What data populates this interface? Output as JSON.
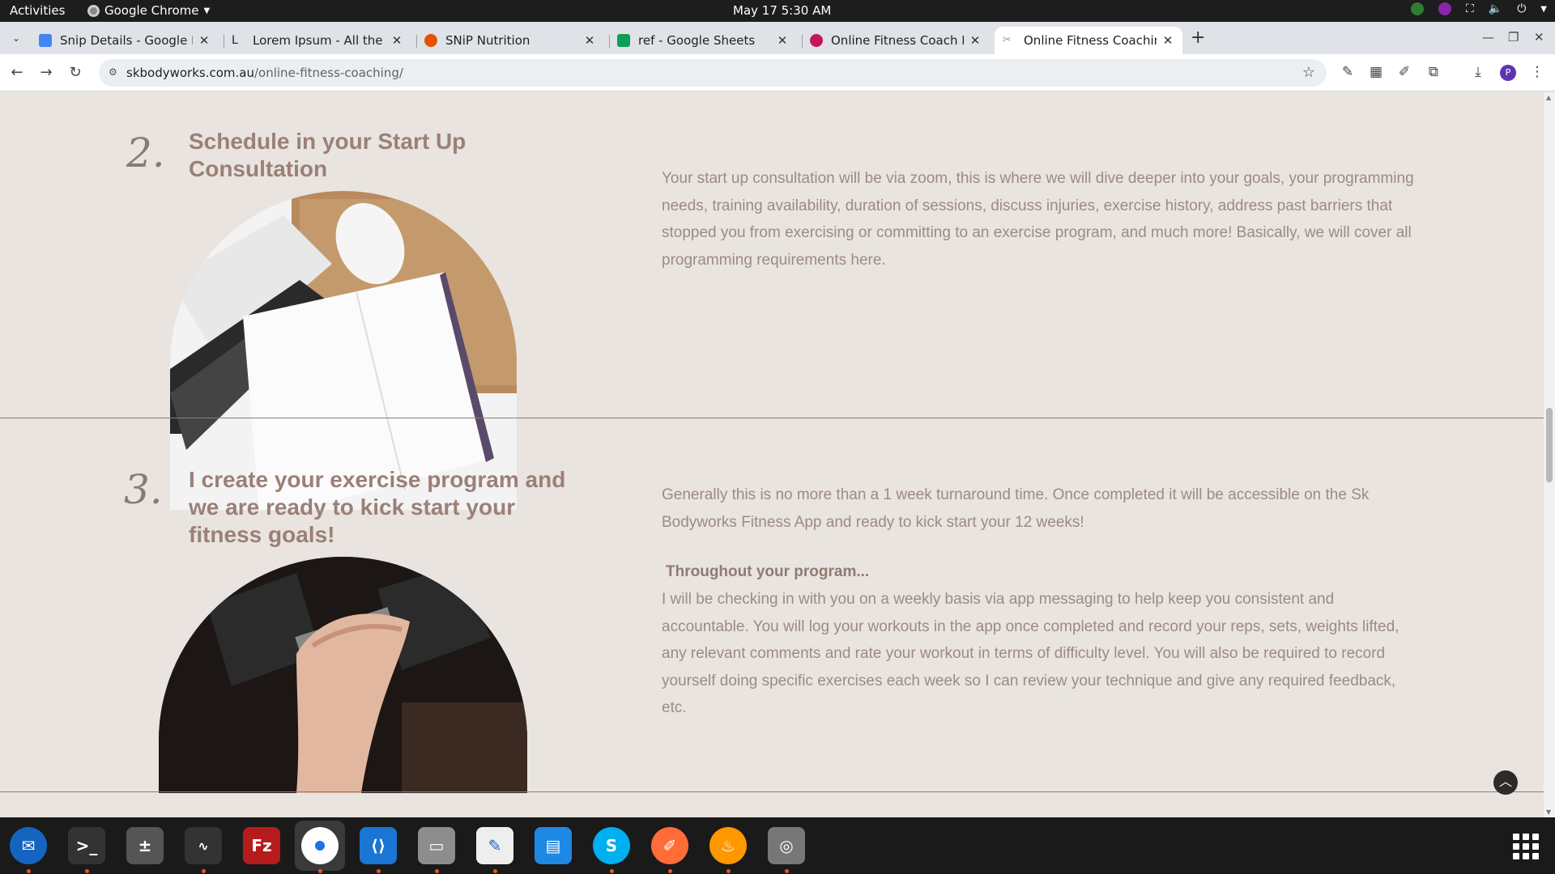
{
  "topbar": {
    "activities": "Activities",
    "app_name": "Google Chrome",
    "clock": "May 17  5:30 AM"
  },
  "tabs": [
    {
      "title": "Snip Details - Google Do",
      "icon": "docs-icon",
      "color": "#4285f4"
    },
    {
      "title": "Lorem Ipsum - All the fac",
      "icon": "lorem-icon",
      "color": "#ffffff"
    },
    {
      "title": "SNiP Nutrition",
      "icon": "snip-icon",
      "color": "#e65100"
    },
    {
      "title": "ref - Google Sheets",
      "icon": "sheets-icon",
      "color": "#0f9d58"
    },
    {
      "title": "Online Fitness Coach Bri",
      "icon": "canva-icon",
      "color": "#c2185b"
    },
    {
      "title": "Online Fitness Coaching",
      "icon": "sk-icon",
      "color": "#cccccc",
      "active": true
    }
  ],
  "address": {
    "domain": "skbodyworks.com.au",
    "path": "/online-fitness-coaching/"
  },
  "profile_initial": "P",
  "steps": [
    {
      "number": "2.",
      "title": "Schedule in your Start Up Consultation",
      "image": "laptop-planner-photo",
      "text": "Your start up consultation will be via zoom, this is where we will dive deeper into your goals, your programming needs, training availability, duration of sessions, discuss injuries, exercise history, address past barriers that stopped you from exercising or committing to an exercise program, and much more! Basically, we will cover all programming requirements here."
    },
    {
      "number": "3.",
      "title": "I create your exercise program and we are ready to kick start your fitness goals!",
      "image": "dumbbell-photo",
      "text": "Generally this is no more than a 1 week turnaround time. Once completed it will be accessible on the Sk Bodyworks Fitness App and ready to kick start your 12 weeks!",
      "subheading": "Throughout your program...",
      "text2": "I will be checking in with you on a weekly basis via app messaging to help keep you consistent and accountable. You will log your workouts in the app once completed and record your reps, sets, weights lifted, any relevant comments and rate your workout in terms of difficulty level. You will also be required to record yourself doing specific exercises each week so I can review your technique and give any required feedback, etc."
    }
  ],
  "dock": [
    {
      "name": "thunderbird",
      "color": "#1565c0",
      "running": true
    },
    {
      "name": "terminal",
      "color": "#333333",
      "running": true
    },
    {
      "name": "calculator",
      "color": "#555555",
      "running": false
    },
    {
      "name": "system-monitor",
      "color": "#333333",
      "running": true
    },
    {
      "name": "filezilla",
      "color": "#b71c1c",
      "running": false
    },
    {
      "name": "chrome",
      "color": "#ffffff",
      "running": true
    },
    {
      "name": "vscode",
      "color": "#1976d2",
      "running": true
    },
    {
      "name": "files",
      "color": "#8d8d8d",
      "running": true
    },
    {
      "name": "text-editor",
      "color": "#eeeeee",
      "running": true
    },
    {
      "name": "libreoffice-writer",
      "color": "#1e88e5",
      "running": false
    },
    {
      "name": "skype",
      "color": "#00aff0",
      "running": true
    },
    {
      "name": "postman",
      "color": "#ff6c37",
      "running": true
    },
    {
      "name": "blender-fire",
      "color": "#ff9800",
      "running": true
    },
    {
      "name": "disk-utility",
      "color": "#777777",
      "running": true
    }
  ]
}
